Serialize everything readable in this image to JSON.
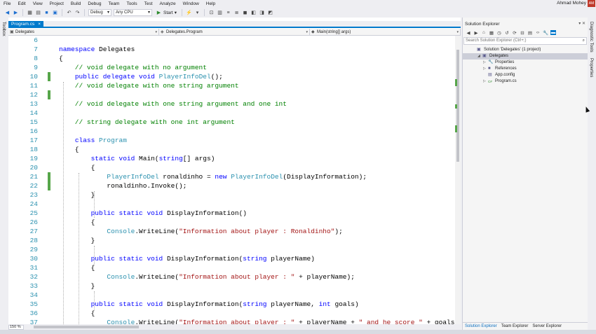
{
  "menu": [
    "File",
    "Edit",
    "View",
    "Project",
    "Build",
    "Debug",
    "Team",
    "Tools",
    "Test",
    "Analyze",
    "Window",
    "Help"
  ],
  "user": {
    "name": "Ahmad Mohey",
    "initials": "AM"
  },
  "toolbar": {
    "config": "Debug",
    "platform": "Any CPU",
    "start_label": "Start"
  },
  "left_rail": {
    "label": "Toolbox"
  },
  "right_rail": {
    "labels": [
      "Diagnostic Tools",
      "Properties"
    ]
  },
  "editor": {
    "tab_label": "Program.cs",
    "tab_close": "×",
    "nav": {
      "project": "Delegates",
      "class": "Delegates.Program",
      "member": "Main(string[] args)"
    },
    "zoom": "150 %",
    "lines": [
      {
        "n": "6",
        "text": "",
        "changed": false
      },
      {
        "n": "7",
        "changed": false,
        "tokens": [
          [
            "namespace",
            "kw"
          ],
          [
            " Delegates",
            ""
          ]
        ]
      },
      {
        "n": "8",
        "changed": false,
        "tokens": [
          [
            "{",
            ""
          ]
        ]
      },
      {
        "n": "9",
        "changed": false,
        "tokens": [
          [
            "    // void delegate with no argument",
            "co"
          ]
        ]
      },
      {
        "n": "10",
        "changed": true,
        "tokens": [
          [
            "    ",
            ""
          ],
          [
            "public",
            "kw"
          ],
          [
            " ",
            ""
          ],
          [
            "delegate",
            "kw"
          ],
          [
            " ",
            ""
          ],
          [
            "void",
            "kw"
          ],
          [
            " ",
            ""
          ],
          [
            "PlayerInfoDel",
            "ty"
          ],
          [
            "();",
            ""
          ]
        ]
      },
      {
        "n": "11",
        "changed": false,
        "tokens": [
          [
            "    // void delegate with one string argument",
            "co"
          ]
        ]
      },
      {
        "n": "12",
        "changed": true,
        "tokens": []
      },
      {
        "n": "13",
        "changed": false,
        "tokens": [
          [
            "    // void delegate with one string argument and one int",
            "co"
          ]
        ]
      },
      {
        "n": "14",
        "changed": false,
        "tokens": []
      },
      {
        "n": "15",
        "changed": false,
        "tokens": [
          [
            "    // string delegate with one int argument",
            "co"
          ]
        ]
      },
      {
        "n": "16",
        "changed": false,
        "tokens": []
      },
      {
        "n": "17",
        "changed": false,
        "tokens": [
          [
            "    ",
            ""
          ],
          [
            "class",
            "kw"
          ],
          [
            " ",
            ""
          ],
          [
            "Program",
            "ty"
          ]
        ]
      },
      {
        "n": "18",
        "changed": false,
        "tokens": [
          [
            "    {",
            ""
          ]
        ]
      },
      {
        "n": "19",
        "changed": false,
        "tokens": [
          [
            "        ",
            ""
          ],
          [
            "static",
            "kw"
          ],
          [
            " ",
            ""
          ],
          [
            "void",
            "kw"
          ],
          [
            " Main(",
            ""
          ],
          [
            "string",
            "kw"
          ],
          [
            "[] args)",
            ""
          ]
        ]
      },
      {
        "n": "20",
        "changed": false,
        "tokens": [
          [
            "        {",
            ""
          ]
        ]
      },
      {
        "n": "21",
        "changed": true,
        "tokens": [
          [
            "            ",
            ""
          ],
          [
            "PlayerInfoDel",
            "ty"
          ],
          [
            " ronaldinho = ",
            ""
          ],
          [
            "new",
            "kw"
          ],
          [
            " ",
            ""
          ],
          [
            "PlayerInfoDel",
            "ty"
          ],
          [
            "(DisplayInformation);",
            ""
          ]
        ]
      },
      {
        "n": "22",
        "changed": true,
        "tokens": [
          [
            "            ronaldinho.Invoke();",
            ""
          ]
        ]
      },
      {
        "n": "23",
        "changed": false,
        "tokens": [
          [
            "        }",
            ""
          ]
        ]
      },
      {
        "n": "24",
        "changed": false,
        "tokens": []
      },
      {
        "n": "25",
        "changed": false,
        "tokens": [
          [
            "        ",
            ""
          ],
          [
            "public",
            "kw"
          ],
          [
            " ",
            ""
          ],
          [
            "static",
            "kw"
          ],
          [
            " ",
            ""
          ],
          [
            "void",
            "kw"
          ],
          [
            " DisplayInformation()",
            ""
          ]
        ]
      },
      {
        "n": "26",
        "changed": false,
        "tokens": [
          [
            "        {",
            ""
          ]
        ]
      },
      {
        "n": "27",
        "changed": false,
        "tokens": [
          [
            "            ",
            ""
          ],
          [
            "Console",
            "ty"
          ],
          [
            ".WriteLine(",
            ""
          ],
          [
            "\"Information about player : Ronaldinho\"",
            "st"
          ],
          [
            ");",
            ""
          ]
        ]
      },
      {
        "n": "28",
        "changed": false,
        "tokens": [
          [
            "        }",
            ""
          ]
        ]
      },
      {
        "n": "29",
        "changed": false,
        "tokens": []
      },
      {
        "n": "30",
        "changed": false,
        "tokens": [
          [
            "        ",
            ""
          ],
          [
            "public",
            "kw"
          ],
          [
            " ",
            ""
          ],
          [
            "static",
            "kw"
          ],
          [
            " ",
            ""
          ],
          [
            "void",
            "kw"
          ],
          [
            " DisplayInformation(",
            ""
          ],
          [
            "string",
            "kw"
          ],
          [
            " playerName)",
            ""
          ]
        ]
      },
      {
        "n": "31",
        "changed": false,
        "tokens": [
          [
            "        {",
            ""
          ]
        ]
      },
      {
        "n": "32",
        "changed": false,
        "tokens": [
          [
            "            ",
            ""
          ],
          [
            "Console",
            "ty"
          ],
          [
            ".WriteLine(",
            ""
          ],
          [
            "\"Information about player : \"",
            "st"
          ],
          [
            " + playerName);",
            ""
          ]
        ]
      },
      {
        "n": "33",
        "changed": false,
        "tokens": [
          [
            "        }",
            ""
          ]
        ]
      },
      {
        "n": "34",
        "changed": false,
        "tokens": []
      },
      {
        "n": "35",
        "changed": false,
        "tokens": [
          [
            "        ",
            ""
          ],
          [
            "public",
            "kw"
          ],
          [
            " ",
            ""
          ],
          [
            "static",
            "kw"
          ],
          [
            " ",
            ""
          ],
          [
            "void",
            "kw"
          ],
          [
            " DisplayInformation(",
            ""
          ],
          [
            "string",
            "kw"
          ],
          [
            " playerName, ",
            ""
          ],
          [
            "int",
            "kw"
          ],
          [
            " goals)",
            ""
          ]
        ]
      },
      {
        "n": "36",
        "changed": false,
        "tokens": [
          [
            "        {",
            ""
          ]
        ]
      },
      {
        "n": "37",
        "changed": false,
        "tokens": [
          [
            "            ",
            ""
          ],
          [
            "Console",
            "ty"
          ],
          [
            ".WriteLine(",
            ""
          ],
          [
            "\"Information about player : \"",
            "st"
          ],
          [
            " + playerName + ",
            ""
          ],
          [
            "\" and he score \"",
            "st"
          ],
          [
            " + goals);",
            ""
          ]
        ]
      }
    ]
  },
  "solution_explorer": {
    "title": "Solution Explorer",
    "title_icons": "▾ ✕",
    "search_placeholder": "Search Solution Explorer (Ctrl+;)",
    "tree": [
      {
        "label": "Solution 'Delegates' (1 project)",
        "depth": 0,
        "arrow": "",
        "icon": "▣",
        "selected": false
      },
      {
        "label": "Delegates",
        "depth": 1,
        "arrow": "◢",
        "icon": "▣",
        "selected": true
      },
      {
        "label": "Properties",
        "depth": 2,
        "arrow": "▷",
        "icon": "🔧",
        "selected": false
      },
      {
        "label": "References",
        "depth": 2,
        "arrow": "▷",
        "icon": "■",
        "selected": false
      },
      {
        "label": "App.config",
        "depth": 2,
        "arrow": "",
        "icon": "▤",
        "selected": false
      },
      {
        "label": "Program.cs",
        "depth": 2,
        "arrow": "▷",
        "icon": "C#",
        "selected": false
      }
    ],
    "bottom_tabs": [
      "Solution Explorer",
      "Team Explorer",
      "Server Explorer"
    ]
  }
}
